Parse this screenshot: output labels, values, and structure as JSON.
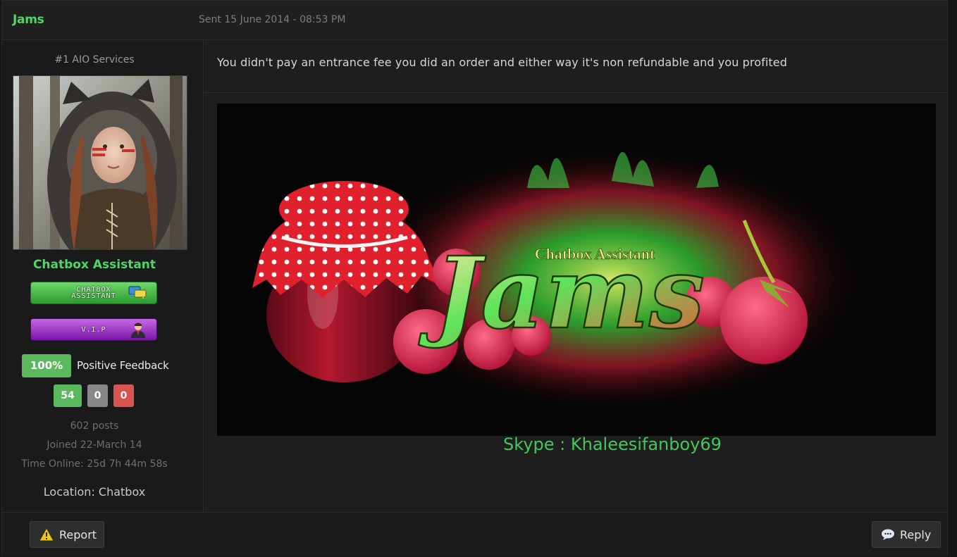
{
  "header": {
    "author_name": "Jams",
    "post_date": "Sent 15 June 2014 - 08:53 PM"
  },
  "sidebar": {
    "user_title": "#1 AIO Services",
    "group_name": "Chatbox Assistant",
    "badges": [
      {
        "text": "CHATBOX ASSISTANT",
        "emblem": "chat-bubbles-icon"
      },
      {
        "text": "V.I.P",
        "emblem": "vip-person-icon"
      }
    ],
    "feedback": {
      "percent": "100%",
      "label": "Positive Feedback",
      "positive": "54",
      "neutral": "0",
      "negative": "0"
    },
    "posts": "602 posts",
    "joined": "Joined 22-March 14",
    "time_online": "Time Online: 25d 7h 44m 58s",
    "location": "Location: Chatbox"
  },
  "post": {
    "message": "You didn't pay an entrance fee you did an order and either way it's non refundable and you profited"
  },
  "signature": {
    "banner_subtitle": "Chatbox Assistant",
    "banner_title": "Jams",
    "skype": "Skype : Khaleesifanboy69"
  },
  "footer": {
    "report_label": "Report",
    "reply_label": "Reply"
  },
  "colors": {
    "accent_green": "#4bd865",
    "feedback_positive": "#5cb85c",
    "feedback_neutral": "#888888",
    "feedback_negative": "#d9534f",
    "vip_purple": "#9b30c8"
  }
}
